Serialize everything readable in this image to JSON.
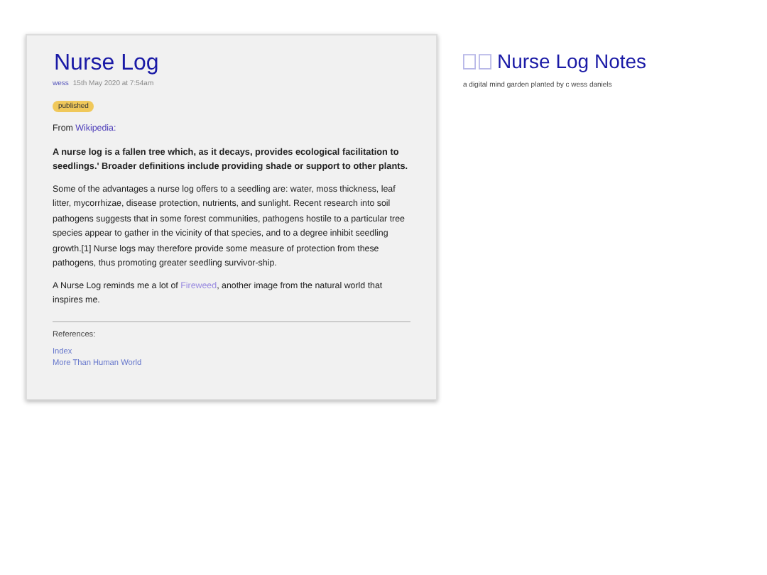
{
  "article": {
    "title": "Nurse Log",
    "author": "wess",
    "date": "15th May 2020 at 7:54am",
    "tag": "published",
    "source_prefix": "From ",
    "source_link": "Wikipedia:",
    "quote": "A nurse log is a fallen tree which, as it decays, provides ecological facilitation to seedlings.' Broader definitions include providing shade or support to other plants.",
    "paragraph": "Some of the advantages a nurse log offers to a seedling are: water, moss thickness, leaf litter, mycorrhizae, disease protection, nutrients, and sunlight. Recent research into soil pathogens suggests that in some forest communities, pathogens hostile to a particular tree species appear to gather in the vicinity of that species, and to a degree inhibit seedling growth.[1] Nurse logs may therefore provide some measure of protection from these pathogens, thus promoting greater seedling survivor-ship.",
    "note_before": "A Nurse Log reminds me a lot of ",
    "note_link": "Fireweed",
    "note_after": ", another image from the natural world that inspires me.",
    "references_label": "References:",
    "references": [
      "Index",
      "More Than Human World"
    ]
  },
  "site": {
    "title": "Nurse Log Notes",
    "subtitle": "a digital mind garden planted by c wess daniels"
  }
}
